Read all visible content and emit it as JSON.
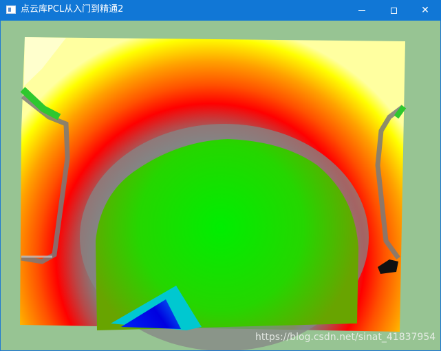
{
  "window": {
    "title": "点云库PCL从入门到精通2",
    "controls": {
      "minimize_icon": "minimize-icon",
      "maximize_icon": "maximize-icon",
      "close_icon": "close-icon",
      "close_glyph": "✕"
    }
  },
  "viewer": {
    "background_color": "#97c493",
    "colormap": [
      "#0000ff",
      "#00ffff",
      "#00ee00",
      "#7f7f7f",
      "#ff0000",
      "#ffff00",
      "#ffffff"
    ]
  },
  "watermark": {
    "text": "https://blog.csdn.net/sinat_41837954"
  }
}
